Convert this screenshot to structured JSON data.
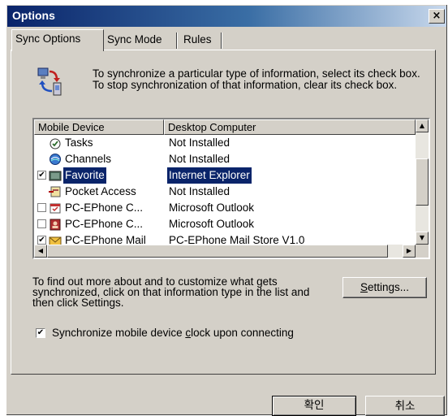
{
  "window": {
    "title": "Options",
    "close_label": "×"
  },
  "tabs": [
    {
      "label": "Sync Options"
    },
    {
      "label": "Sync Mode"
    },
    {
      "label": "Rules"
    }
  ],
  "intro_text": "To synchronize a particular type of information, select its check box. To stop synchronization of that information, clear its check box.",
  "list": {
    "columns": [
      "Mobile Device",
      "Desktop Computer"
    ],
    "rows": [
      {
        "name": "Tasks",
        "desktop": "Not Installed",
        "checkbox": false,
        "checked": false,
        "selected": false,
        "icon": "tasks-icon"
      },
      {
        "name": "Channels",
        "desktop": "Not Installed",
        "checkbox": false,
        "checked": false,
        "selected": false,
        "icon": "channels-icon"
      },
      {
        "name": "Favorite",
        "desktop": "Internet Explorer",
        "checkbox": true,
        "checked": true,
        "selected": true,
        "icon": "favorite-icon"
      },
      {
        "name": "Pocket Access",
        "desktop": "Not Installed",
        "checkbox": false,
        "checked": false,
        "selected": false,
        "icon": "pocket-access-icon"
      },
      {
        "name": "PC-EPhone C...",
        "desktop": "Microsoft Outlook",
        "checkbox": true,
        "checked": false,
        "selected": false,
        "icon": "calendar-icon"
      },
      {
        "name": "PC-EPhone C...",
        "desktop": "Microsoft Outlook",
        "checkbox": true,
        "checked": false,
        "selected": false,
        "icon": "contacts-icon"
      },
      {
        "name": "PC-EPhone Mail",
        "desktop": "PC-EPhone Mail Store V1.0",
        "checkbox": true,
        "checked": true,
        "selected": false,
        "icon": "mail-icon"
      }
    ]
  },
  "help_text": "To find out more about and to customize what gets synchronized, click on that information type in the list and then click Settings.",
  "settings_button": {
    "pre": "",
    "accel": "S",
    "post": "ettings..."
  },
  "clock_checkbox": {
    "checked": true,
    "pre": "Synchronize mobile device ",
    "accel": "c",
    "post": "lock upon connecting"
  },
  "buttons": {
    "ok": "확인",
    "cancel": "취소"
  }
}
